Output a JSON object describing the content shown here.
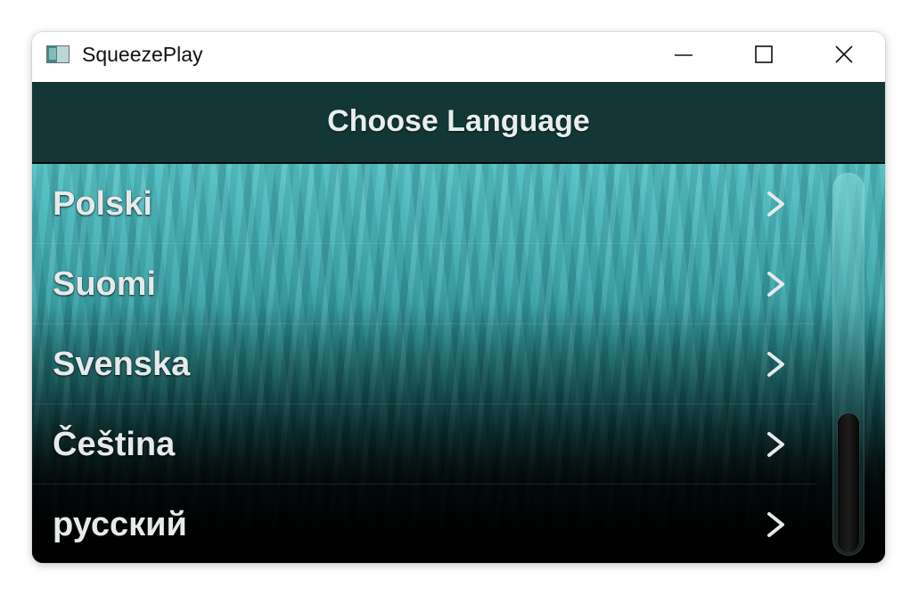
{
  "window": {
    "title": "SqueezePlay",
    "controls": {
      "minimize": "minimize-icon",
      "maximize": "maximize-icon",
      "close": "close-icon"
    }
  },
  "header": {
    "title": "Choose Language"
  },
  "languages": [
    {
      "label": "Polski"
    },
    {
      "label": "Suomi"
    },
    {
      "label": "Svenska"
    },
    {
      "label": "Čeština"
    },
    {
      "label": "русский"
    }
  ],
  "scroll": {
    "position_fraction": 1.0
  },
  "colors": {
    "header_bg": "#133737",
    "accent_teal": "#3aa6aa",
    "text": "#e6eaea"
  }
}
